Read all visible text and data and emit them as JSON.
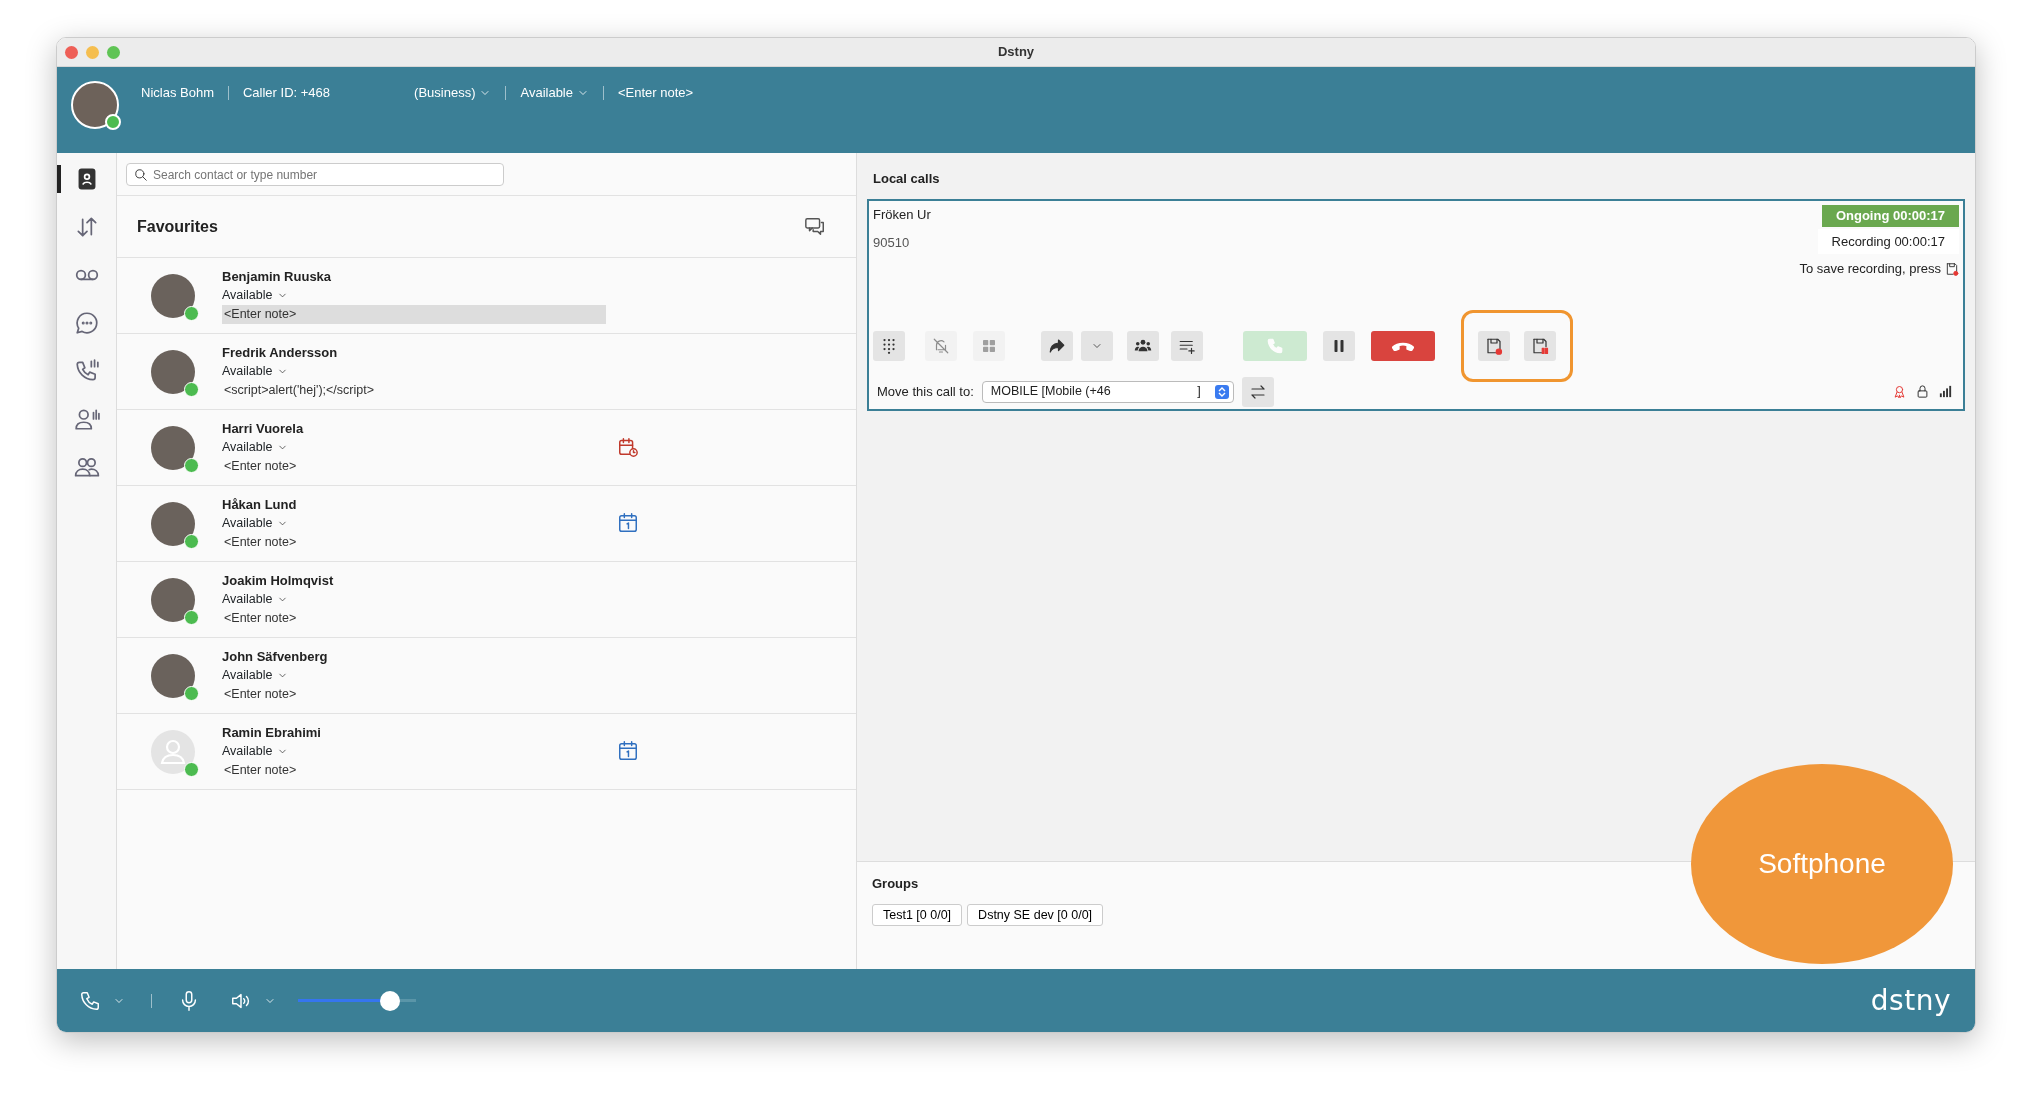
{
  "window": {
    "title": "Dstny"
  },
  "header": {
    "name": "Niclas Bohm",
    "caller_id": "Caller ID: +468",
    "profile": "(Business)",
    "status": "Available",
    "note": "<Enter note>",
    "online": true
  },
  "sidebar": {
    "items": [
      {
        "kind": "contacts",
        "selected": true
      },
      {
        "kind": "transfers",
        "selected": false
      },
      {
        "kind": "voicemail",
        "selected": false
      },
      {
        "kind": "chat",
        "selected": false
      },
      {
        "kind": "call-stats",
        "selected": false
      },
      {
        "kind": "agent-stats",
        "selected": false
      },
      {
        "kind": "groups",
        "selected": false
      }
    ]
  },
  "search": {
    "placeholder": "Search contact or type number"
  },
  "favourites": {
    "title": "Favourites",
    "contacts": [
      {
        "name": "Benjamin Ruuska",
        "status": "Available",
        "note": "<Enter note>",
        "avatar": {
          "kind": "photo"
        },
        "online": true,
        "note_focused": true
      },
      {
        "name": "Fredrik Andersson",
        "status": "Available",
        "note": "<script>alert('hej');</script>",
        "avatar": {
          "kind": "photo"
        },
        "online": true,
        "note_focused": false
      },
      {
        "name": "Harri Vuorela",
        "status": "Available",
        "note": "<Enter note>",
        "avatar": {
          "kind": "photo"
        },
        "online": true,
        "note_focused": false,
        "calendar": {
          "kind": "reminder"
        }
      },
      {
        "name": "Håkan Lund",
        "status": "Available",
        "note": "<Enter note>",
        "avatar": {
          "kind": "photo"
        },
        "online": true,
        "note_focused": false,
        "calendar": {
          "kind": "day"
        }
      },
      {
        "name": "Joakim Holmqvist",
        "status": "Available",
        "note": "<Enter note>",
        "avatar": {
          "kind": "photo"
        },
        "online": true,
        "note_focused": false
      },
      {
        "name": "John Säfvenberg",
        "status": "Available",
        "note": "<Enter note>",
        "avatar": {
          "kind": "photo"
        },
        "online": true,
        "note_focused": false
      },
      {
        "name": "Ramin Ebrahimi",
        "status": "Available",
        "note": "<Enter note>",
        "avatar": {
          "kind": "generic"
        },
        "online": true,
        "note_focused": false,
        "calendar": {
          "kind": "day"
        }
      }
    ]
  },
  "local_calls": {
    "title": "Local calls",
    "call": {
      "name": "Fröken Ur",
      "number": "90510",
      "status": "Ongoing 00:00:17",
      "recording": "Recording 00:00:17",
      "save_hint": "To save recording, press",
      "buttons": [
        {
          "kind": "dialpad",
          "disabled": false
        },
        {
          "kind": "mute",
          "disabled": true
        },
        {
          "kind": "grid",
          "disabled": true
        },
        {
          "kind": "transfer",
          "disabled": false
        },
        {
          "kind": "caret",
          "disabled": false
        },
        {
          "kind": "conference",
          "disabled": false
        },
        {
          "kind": "add-to-list",
          "disabled": false
        },
        {
          "kind": "answer",
          "disabled": true
        },
        {
          "kind": "hold",
          "disabled": false
        },
        {
          "kind": "hangup",
          "disabled": false
        }
      ],
      "highlighted_buttons": [
        {
          "kind": "record",
          "disabled": false
        },
        {
          "kind": "record-pause",
          "disabled": false
        }
      ],
      "move_label": "Move this call to:",
      "move_value": "MOBILE [Mobile (+46",
      "move_value_end": "]"
    }
  },
  "groups": {
    "title": "Groups",
    "items": [
      "Test1 [0 0/0]",
      "Dstny SE dev [0 0/0]"
    ]
  },
  "bottom_bar": {
    "volume": {
      "level": 0.78
    },
    "logo": "dstny"
  },
  "annotation": {
    "label": "Softphone"
  }
}
